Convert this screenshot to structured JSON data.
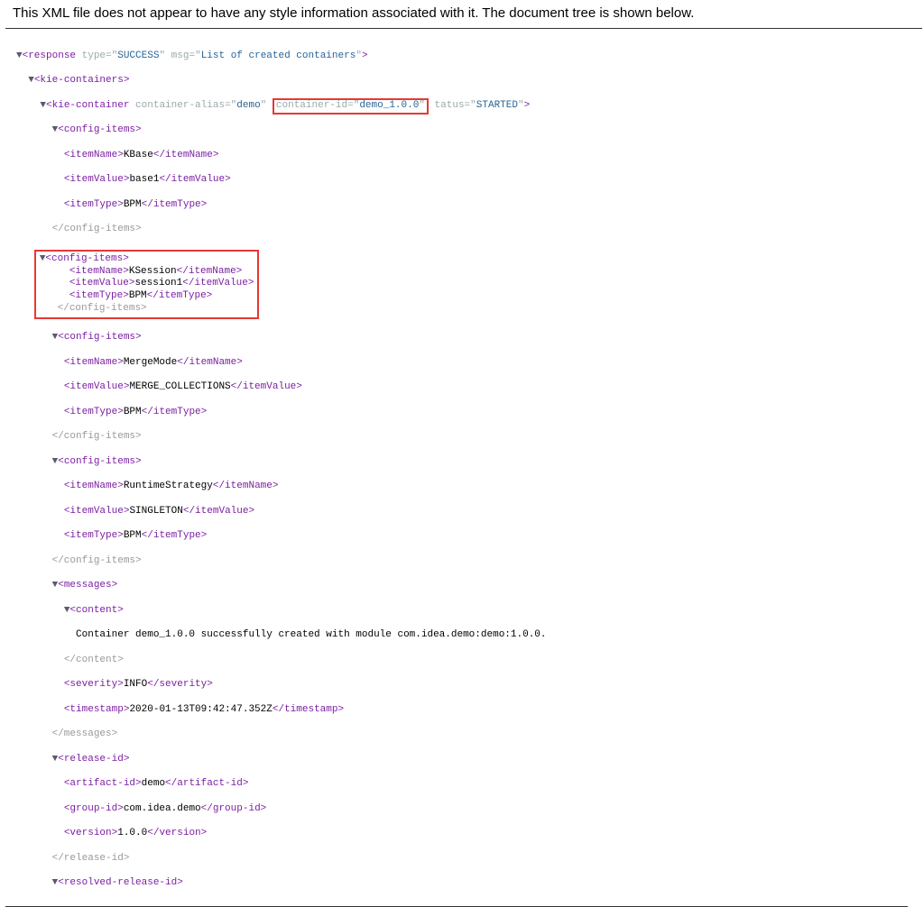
{
  "header": "This XML file does not appear to have any style information associated with it. The document tree is shown below.",
  "response": {
    "type_attr": "type=\"",
    "type_val": "SUCCESS",
    "msg_attr": "msg=\"",
    "msg_val": "List of created containers"
  },
  "kieContainer": {
    "alias_attr": "container-alias=\"",
    "alias_val": "demo",
    "id_attr": "container-id=\"",
    "id_val": "demo_1.0.0",
    "status_attr": "tatus=\"",
    "status_val": "STARTED"
  },
  "config1": {
    "itemName": "KBase",
    "itemValue": "base1",
    "itemType": "BPM"
  },
  "config2": {
    "itemName": "KSession",
    "itemValue": "session1",
    "itemType": "BPM"
  },
  "config3": {
    "itemName": "MergeMode",
    "itemValue": "MERGE_COLLECTIONS",
    "itemType": "BPM"
  },
  "config4": {
    "itemName": "RuntimeStrategy",
    "itemValue": "SINGLETON",
    "itemType": "BPM"
  },
  "messages": {
    "content": "Container demo_1.0.0 successfully created with module com.idea.demo:demo:1.0.0.",
    "severity": "INFO",
    "timestamp": "2020-01-13T09:42:47.352Z"
  },
  "release": {
    "artifact": "demo",
    "group": "com.idea.demo",
    "version": "1.0.0"
  },
  "tags": {
    "response_open": "<response ",
    "kie_containers_open": "<kie-containers>",
    "kie_container_open": "<kie-container ",
    "config_items_open": "<config-items>",
    "config_items_close": "</config-items>",
    "itemName_open": "<itemName>",
    "itemName_close": "</itemName>",
    "itemValue_open": "<itemValue>",
    "itemValue_close": "</itemValue>",
    "itemType_open": "<itemType>",
    "itemType_close": "</itemType>",
    "messages_open": "<messages>",
    "messages_close": "</messages>",
    "content_open": "<content>",
    "content_close": "</content>",
    "severity_open": "<severity>",
    "severity_close": "</severity>",
    "timestamp_open": "<timestamp>",
    "timestamp_close": "</timestamp>",
    "release_open": "<release-id>",
    "release_close": "</release-id>",
    "artifact_open": "<artifact-id>",
    "artifact_close": "</artifact-id>",
    "group_open": "<group-id>",
    "group_close": "</group-id>",
    "version_open": "<version>",
    "version_close": "</version>",
    "resolved_open": "<resolved-release-id>",
    "gt": ">",
    "q": "\""
  },
  "toggle": "▼",
  "watermark": ""
}
